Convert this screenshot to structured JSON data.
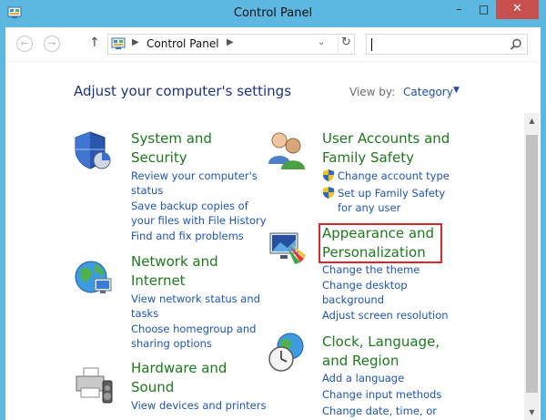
{
  "window": {
    "title": "Control Panel",
    "minimize_glyph": "–",
    "maximize_glyph": "□",
    "close_glyph": "✕"
  },
  "navbar": {
    "back_glyph": "←",
    "forward_glyph": "→",
    "up_glyph": "↑",
    "address_sep_glyph": "▶",
    "address_path": "Control Panel",
    "address_dropdown_glyph": "⌄",
    "refresh_glyph": "↻",
    "search_value": ""
  },
  "content": {
    "heading": "Adjust your computer's settings",
    "view_by_label": "View by:",
    "view_by_value": "Category",
    "view_by_caret": "▼"
  },
  "categories": {
    "system": {
      "title_lines": [
        "System and",
        "Security"
      ],
      "links": [
        [
          "Review your computer's",
          "status"
        ],
        [
          "Save backup copies of",
          "your files with File History"
        ],
        [
          "Find and fix problems"
        ]
      ]
    },
    "network": {
      "title_lines": [
        "Network and",
        "Internet"
      ],
      "links": [
        [
          "View network status and",
          "tasks"
        ],
        [
          "Choose homegroup and",
          "sharing options"
        ]
      ]
    },
    "hardware": {
      "title_lines": [
        "Hardware and",
        "Sound"
      ],
      "links": [
        [
          "View devices and printers"
        ]
      ]
    },
    "users": {
      "title_lines": [
        "User Accounts and",
        "Family Safety"
      ],
      "links": [
        [
          "Change account type"
        ],
        [
          "Set up Family Safety",
          "for any user"
        ]
      ]
    },
    "appearance": {
      "title_lines": [
        "Appearance and",
        "Personalization"
      ],
      "links": [
        [
          "Change the theme"
        ],
        [
          "Change desktop",
          "background"
        ],
        [
          "Adjust screen resolution"
        ]
      ]
    },
    "clock": {
      "title_lines": [
        "Clock, Language,",
        "and Region"
      ],
      "links": [
        [
          "Add a language"
        ],
        [
          "Change input methods"
        ],
        [
          "Change date, time, or"
        ]
      ]
    }
  },
  "scrollbar": {
    "up_glyph": "▲",
    "down_glyph": "▼"
  },
  "colors": {
    "window_frame": "#5cb7e1",
    "close_button": "#c7504f",
    "heading": "#1e3287",
    "category_title": "#1c7a1c",
    "link": "#1f55b5",
    "highlight_border": "#d8282d"
  }
}
